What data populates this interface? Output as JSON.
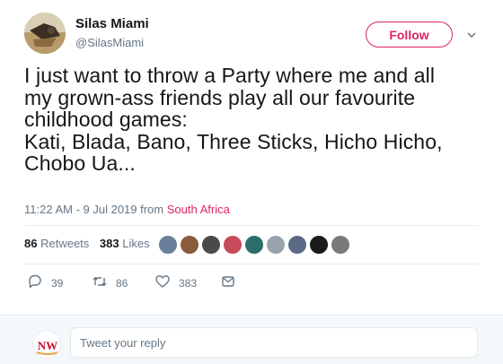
{
  "user": {
    "display_name": "Silas Miami",
    "handle": "@SilasMiami",
    "avatar_icon": "user-avatar"
  },
  "follow_label": "Follow",
  "tweet": {
    "lines": [
      "I just want to throw a Party where me and all",
      "my grown-ass friends play all our favourite",
      "childhood games:",
      "Kati, Blada, Bano, Three Sticks, Hicho Hicho,",
      "Chobo Ua..."
    ]
  },
  "meta": {
    "time_date": "11:22 AM - 9 Jul 2019 from ",
    "location": "South Africa"
  },
  "stats": {
    "retweets_count": "86",
    "retweets_label": "Retweets",
    "likes_count": "383",
    "likes_label": "Likes"
  },
  "likers": [
    {
      "color": "#6b7f9a"
    },
    {
      "color": "#8a5a3c"
    },
    {
      "color": "#4a4a4a"
    },
    {
      "color": "#c74a5a"
    },
    {
      "color": "#2e6e6a"
    },
    {
      "color": "#9aa3ad"
    },
    {
      "color": "#5b6a86"
    },
    {
      "color": "#1a1a1a"
    },
    {
      "color": "#7a7a7a"
    }
  ],
  "actions": {
    "reply_count": "39",
    "retweet_count": "86",
    "like_count": "383"
  },
  "reply": {
    "placeholder": "Tweet your reply",
    "avatar_text": "NW"
  },
  "colors": {
    "accent": "#e0245e",
    "secondary_text": "#657786"
  }
}
